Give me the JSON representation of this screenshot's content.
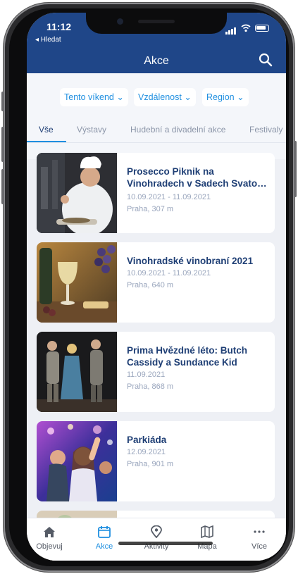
{
  "status": {
    "time": "11:12",
    "back_label": "◂ Hledat"
  },
  "header": {
    "title": "Akce"
  },
  "filters": [
    "Tento víkend ⌄",
    "Vzdálenost ⌄",
    "Region ⌄"
  ],
  "tabs": [
    "Vše",
    "Výstavy",
    "Hudební a divadelní akce",
    "Festivaly"
  ],
  "active_tab": "Vše",
  "events": [
    {
      "title": "Prosecco Piknik na Vinohradech v Sadech Svato…",
      "dates": "10.09.2021 - 11.09.2021",
      "location": "Praha, 307 m"
    },
    {
      "title": "Vinohradské vinobraní 2021",
      "dates": "10.09.2021 - 11.09.2021",
      "location": "Praha, 640 m"
    },
    {
      "title": "Prima Hvězdné léto: Butch Cassidy a Sundance Kid",
      "dates": "11.09.2021",
      "location": "Praha, 868 m"
    },
    {
      "title": "Parkiáda",
      "dates": "12.09.2021",
      "location": "Praha, 901 m"
    }
  ],
  "tabbar": [
    {
      "label": "Objevuj",
      "icon": "home-icon"
    },
    {
      "label": "Akce",
      "icon": "calendar-icon"
    },
    {
      "label": "Aktivity",
      "icon": "location-pin-icon"
    },
    {
      "label": "Mapa",
      "icon": "map-icon"
    },
    {
      "label": "Více",
      "icon": "more-icon"
    }
  ],
  "colors": {
    "header": "#1f4688",
    "accent": "#1f8fe0",
    "title_text": "#1f3f75",
    "meta_text": "#9aa6bd"
  }
}
